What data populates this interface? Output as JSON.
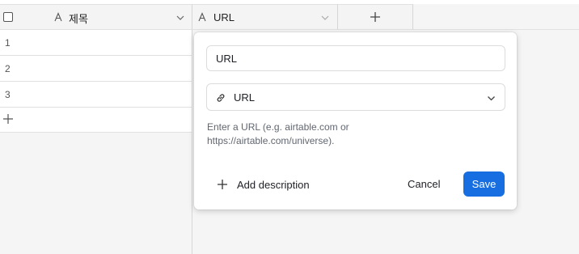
{
  "header": {
    "title_field": {
      "label": "제목",
      "icon": "text-field-icon"
    },
    "url_field": {
      "label": "URL",
      "icon": "text-field-icon"
    },
    "add_field_icon": "plus-icon"
  },
  "rows": [
    {
      "number": "1"
    },
    {
      "number": "2"
    },
    {
      "number": "3"
    }
  ],
  "field_editor": {
    "name_value": "URL",
    "type_label": "URL",
    "type_icon": "link-icon",
    "help_text": "Enter a URL (e.g. airtable.com or https://airtable.com/universe).",
    "add_description_label": "Add description",
    "cancel_label": "Cancel",
    "save_label": "Save"
  },
  "colors": {
    "primary": "#166ee1",
    "background": "#f5f5f5"
  }
}
